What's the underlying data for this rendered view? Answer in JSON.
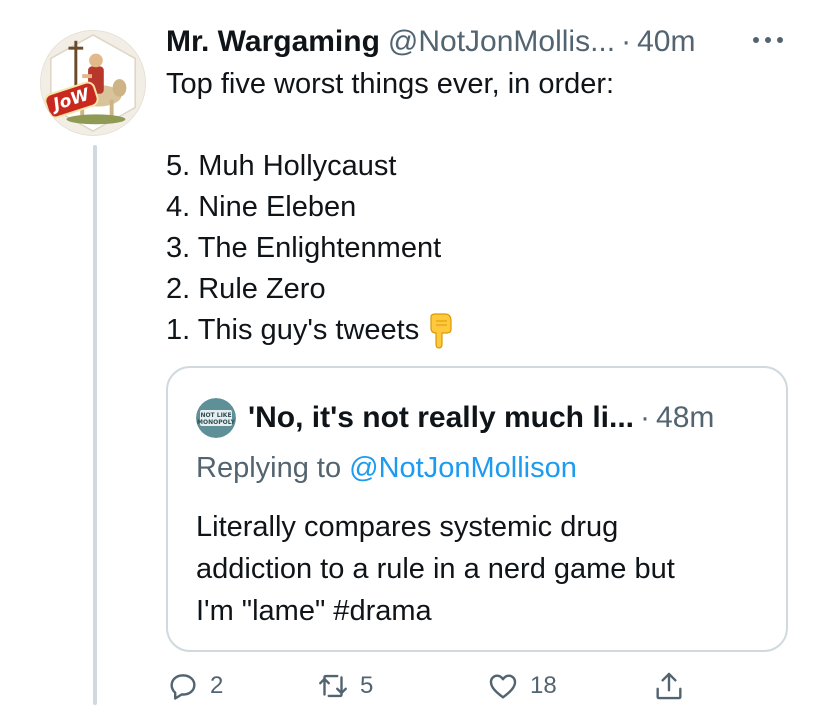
{
  "tweet": {
    "author": {
      "name": "Mr. Wargaming",
      "handle": "@NotJonMollis...",
      "avatar_badge": "JoW"
    },
    "separator": "·",
    "time": "40m",
    "more_icon": "more-horizontal-icon",
    "lines": [
      "Top five worst things ever, in order:",
      "",
      "5. Muh Hollycaust",
      "4. Nine Eleben",
      "3. The Enlightenment",
      "2. Rule Zero",
      "1.  This guy's tweets"
    ],
    "emoji": "backhand-index-pointing-down"
  },
  "quote": {
    "author": {
      "name": "'No, it's not really much li...",
      "avatar_text": "NOT LIKE MONOPOLY"
    },
    "separator": "·",
    "time": "48m",
    "replying_prefix": "Replying to ",
    "replying_handle": "@NotJonMollison",
    "text_lines": [
      "Literally compares systemic drug",
      "addiction to a rule in a nerd game but",
      "I'm \"lame\" #drama"
    ]
  },
  "actions": {
    "reply": {
      "icon": "reply-icon",
      "count": "2"
    },
    "retweet": {
      "icon": "retweet-icon",
      "count": "5"
    },
    "like": {
      "icon": "heart-icon",
      "count": "18"
    },
    "share": {
      "icon": "share-icon"
    }
  },
  "colors": {
    "text": "#0f1419",
    "secondary": "#536471",
    "link": "#1d9bf0",
    "border": "#cfd9de",
    "badge_red": "#c8281e"
  }
}
